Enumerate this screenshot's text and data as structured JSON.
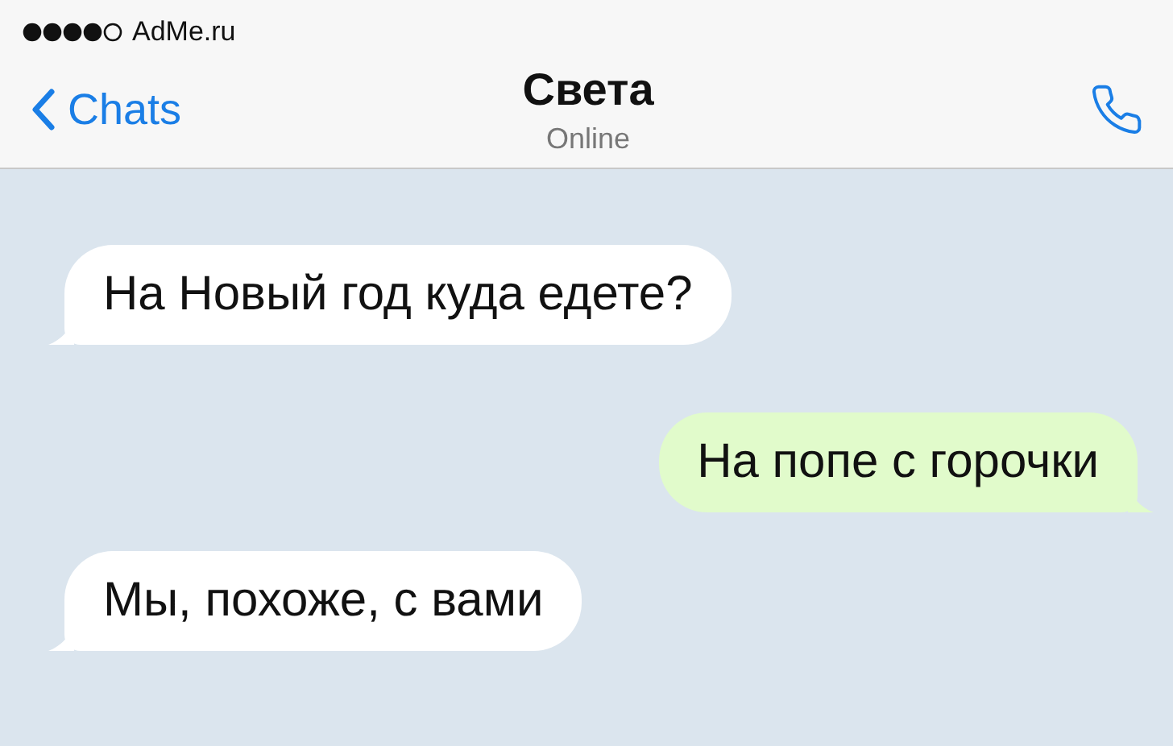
{
  "status_bar": {
    "carrier": "AdMe.ru"
  },
  "header": {
    "back_label": "Chats",
    "title": "Света",
    "subtitle": "Online"
  },
  "messages": [
    {
      "text": "На Новый год куда едете?",
      "kind": "incoming"
    },
    {
      "text": "На попе с горочки",
      "kind": "outgoing"
    },
    {
      "text": "Мы, похоже, с вами",
      "kind": "incoming"
    }
  ]
}
